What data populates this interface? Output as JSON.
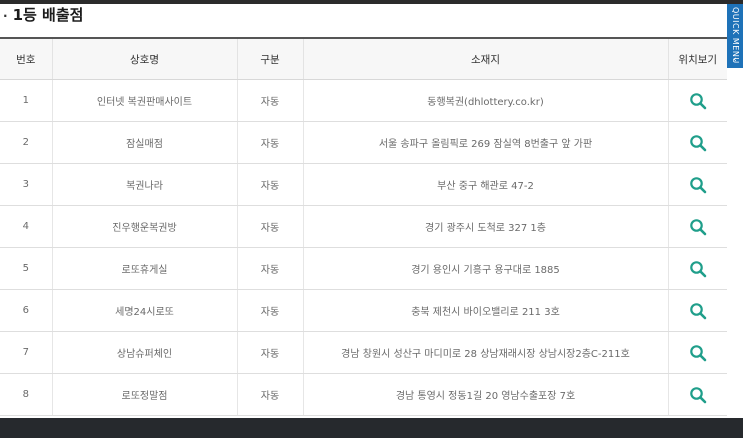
{
  "section": {
    "bullet": "·",
    "title": "1등 배출점"
  },
  "quick_menu": {
    "label": "QUICK MENU",
    "chevron": "‹"
  },
  "table": {
    "headers": [
      "번호",
      "상호명",
      "구분",
      "소재지",
      "위치보기"
    ],
    "rows": [
      {
        "no": "1",
        "name": "인터넷 복권판매사이트",
        "type": "자동",
        "address": "동행복권(dhlottery.co.kr)"
      },
      {
        "no": "2",
        "name": "잠실매점",
        "type": "자동",
        "address": "서울 송파구 올림픽로 269 잠실역 8번출구 앞 가판"
      },
      {
        "no": "3",
        "name": "복권나라",
        "type": "자동",
        "address": "부산 중구 해관로 47-2"
      },
      {
        "no": "4",
        "name": "진우행운복권방",
        "type": "자동",
        "address": "경기 광주시 도척로 327 1층"
      },
      {
        "no": "5",
        "name": "로또휴게실",
        "type": "자동",
        "address": "경기 용인시 기흥구 용구대로 1885"
      },
      {
        "no": "6",
        "name": "세명24시로또",
        "type": "자동",
        "address": "충북 제천시 바이오밸리로 211 3호"
      },
      {
        "no": "7",
        "name": "상남슈퍼체인",
        "type": "자동",
        "address": "경남 창원시 성산구 마디미로 28 상남재래시장 상남시장2층C-211호"
      },
      {
        "no": "8",
        "name": "로또정말점",
        "type": "자동",
        "address": "경남 통영시 정동1길 20 영남수출포장 7호"
      }
    ]
  },
  "icon": {
    "name": "search-icon",
    "color": "#1f9e8a"
  }
}
